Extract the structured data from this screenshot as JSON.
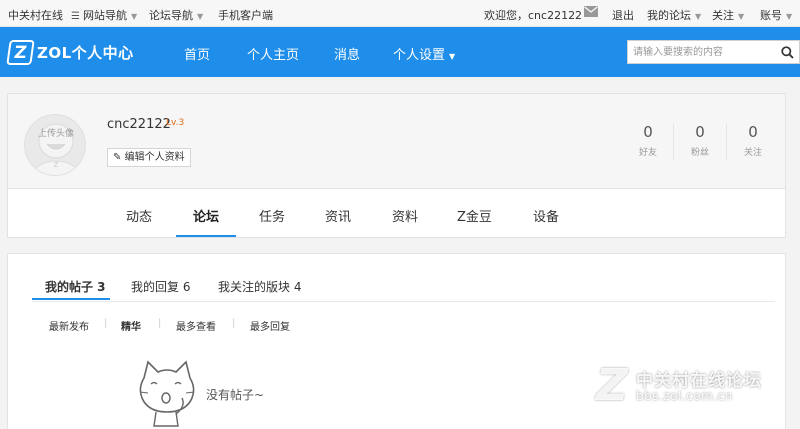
{
  "topbar": {
    "site_name": "中关村在线",
    "site_nav": "网站导航",
    "forum_nav": "论坛导航",
    "mobile_client": "手机客户端",
    "welcome": "欢迎您，cnc22122",
    "logout": "退出",
    "my_forum": "我的论坛",
    "follow": "关注",
    "account": "账号"
  },
  "header": {
    "logo_letter": "Z",
    "logo_text": "ZOL个人中心",
    "nav": [
      "首页",
      "个人主页",
      "消息",
      "个人设置"
    ],
    "search_placeholder": "请输入要搜索的内容"
  },
  "profile": {
    "avatar_text": "上传头像",
    "username": "cnc22122",
    "level": "Lv.3",
    "edit_label": "编辑个人资料",
    "stats": [
      {
        "value": "0",
        "label": "好友"
      },
      {
        "value": "0",
        "label": "粉丝"
      },
      {
        "value": "0",
        "label": "关注"
      }
    ],
    "tabs": [
      "动态",
      "论坛",
      "任务",
      "资讯",
      "资料",
      "Z金豆",
      "设备"
    ],
    "active_tab": "论坛"
  },
  "main": {
    "tabs": [
      "我的帖子 3",
      "我的回复 6",
      "我关注的版块 4"
    ],
    "sort": [
      "最新发布",
      "精华",
      "最多查看",
      "最多回复"
    ],
    "empty_text": "没有帖子~"
  },
  "watermark": {
    "letter": "Z",
    "title": "中关村在线论坛",
    "url": "bbs.zol.com.cn"
  },
  "colors": {
    "brand_blue": "#1f8eea",
    "level_orange": "#e06a1b"
  }
}
